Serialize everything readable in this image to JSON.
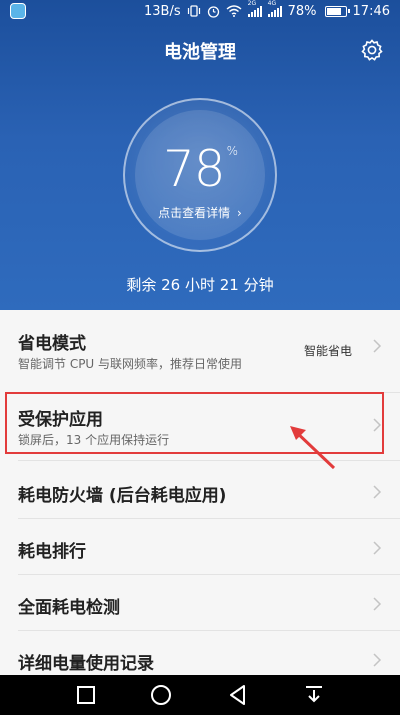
{
  "statusbar": {
    "network_speed": "13B/s",
    "net_2g": "2G",
    "net_4g": "4G",
    "battery": "78%",
    "time": "17:46"
  },
  "header": {
    "title": "电池管理",
    "battery_percent": "78",
    "percent_sign": "%",
    "detail_link": "点击查看详情",
    "remaining": "剩余 26 小时 21 分钟",
    "settings_icon": "gear-icon"
  },
  "list": {
    "items": [
      {
        "label": "省电模式",
        "sub": "智能调节 CPU 与联网频率，推荐日常使用",
        "value": "智能省电"
      },
      {
        "label": "受保护应用",
        "sub": "锁屏后，13 个应用保持运行"
      },
      {
        "label": "耗电防火墙 (后台耗电应用)"
      },
      {
        "label": "耗电排行"
      },
      {
        "label": "全面耗电检测"
      },
      {
        "label": "详细电量使用记录"
      }
    ]
  },
  "annotation": {
    "highlight_color": "#e23b3b"
  },
  "colors": {
    "header_top": "#1c4f9c",
    "header_bottom": "#2f6bbd"
  }
}
